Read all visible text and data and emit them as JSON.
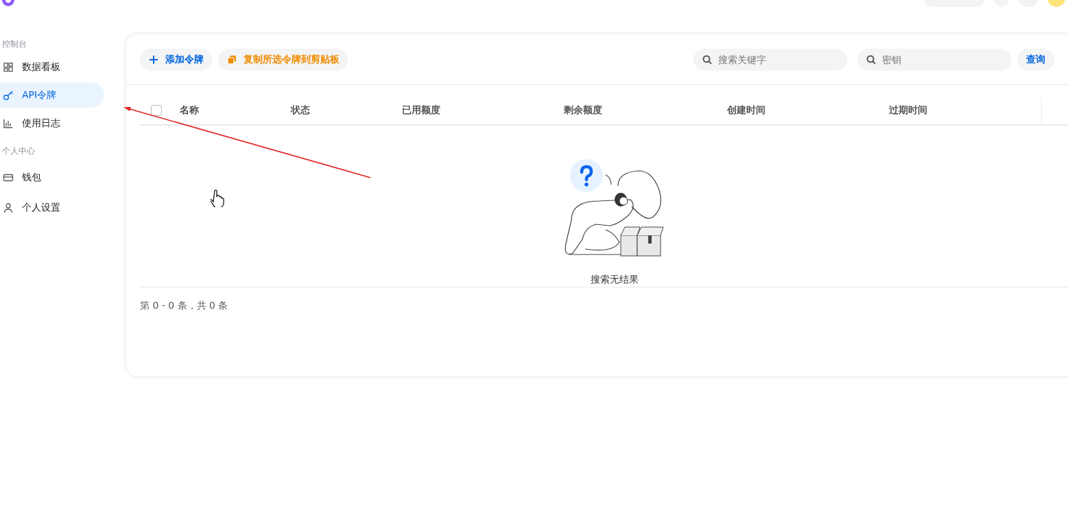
{
  "sidebar": {
    "sections": [
      {
        "title": "控制台",
        "items": [
          {
            "label": "数据看板",
            "selected": false
          },
          {
            "label": "API令牌",
            "selected": true
          },
          {
            "label": "使用日志",
            "selected": false
          }
        ]
      },
      {
        "title": "个人中心",
        "items": [
          {
            "label": "钱包",
            "selected": false
          },
          {
            "label": "个人设置",
            "selected": false
          }
        ]
      }
    ]
  },
  "toolbar": {
    "add_button": "添加令牌",
    "copy_button": "复制所选令牌到剪贴板",
    "search_placeholder": "搜索关键字",
    "key_placeholder": "密钥",
    "query_button": "查询"
  },
  "table": {
    "select_all_checked": false,
    "columns": [
      "名称",
      "状态",
      "已用额度",
      "剩余额度",
      "创建时间",
      "过期时间"
    ],
    "empty_text": "搜索无结果"
  },
  "pagination": {
    "summary": "第 0 - 0 条，共 0 条"
  }
}
